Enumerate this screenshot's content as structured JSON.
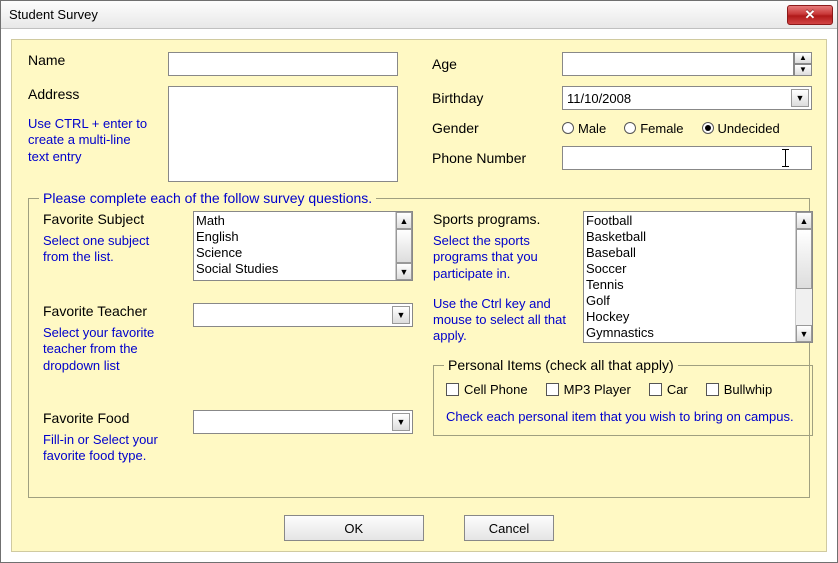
{
  "window": {
    "title": "Student Survey"
  },
  "top": {
    "name_label": "Name",
    "name_value": "",
    "address_label": "Address",
    "address_value": "",
    "address_hint": "Use CTRL + enter to create a multi-line text entry",
    "age_label": "Age",
    "age_value": "",
    "birthday_label": "Birthday",
    "birthday_value": "11/10/2008",
    "gender_label": "Gender",
    "gender_options": {
      "male": "Male",
      "female": "Female",
      "undecided": "Undecided"
    },
    "gender_selected": "undecided",
    "phone_label": "Phone Number",
    "phone_value": ""
  },
  "survey": {
    "legend": "Please complete each of the follow survey questions.",
    "fav_subject_label": "Favorite Subject",
    "fav_subject_hint": "Select one subject from the list.",
    "fav_subject_items": [
      "Math",
      "English",
      "Science",
      "Social Studies"
    ],
    "fav_teacher_label": "Favorite Teacher",
    "fav_teacher_hint": "Select your favorite teacher from the dropdown list",
    "fav_teacher_value": "",
    "fav_food_label": "Favorite Food",
    "fav_food_hint": "Fill-in or Select your favorite food type.",
    "fav_food_value": "",
    "sports_label": "Sports programs.",
    "sports_hint1": "Select the sports programs that you participate in.",
    "sports_hint2": "Use the Ctrl key and mouse to select all that apply.",
    "sports_items": [
      "Football",
      "Basketball",
      "Baseball",
      "Soccer",
      "Tennis",
      "Golf",
      "Hockey",
      "Gymnastics"
    ],
    "personal_legend": "Personal Items (check all that apply)",
    "personal_items": {
      "cell": "Cell Phone",
      "mp3": "MP3 Player",
      "car": "Car",
      "bullwhip": "Bullwhip"
    },
    "personal_hint": "Check each personal item that you wish to bring on campus."
  },
  "buttons": {
    "ok": "OK",
    "cancel": "Cancel"
  }
}
